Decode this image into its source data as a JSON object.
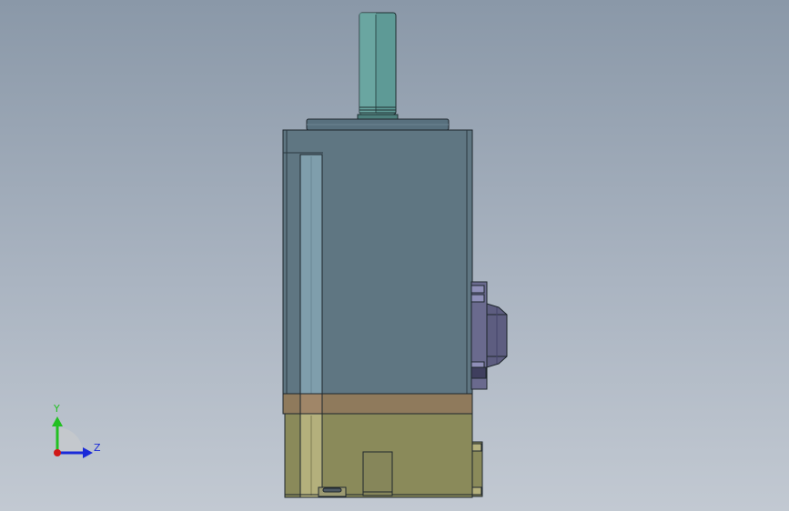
{
  "viewport": {
    "background_top": "#8a98a8",
    "background_bottom": "#c2c9d2"
  },
  "model": {
    "parts": [
      "motor-shaft",
      "shaft-flange",
      "motor-body",
      "side-rail",
      "brown-band",
      "gearbox-base",
      "base-slot",
      "base-clip",
      "side-connector",
      "side-terminal"
    ],
    "colors": {
      "shaft": "#5e9a96",
      "flange": "#58707e",
      "body": "#5f7682",
      "rail": "#7f9eac",
      "band": "#8f7a5c",
      "base": "#8a8a5a",
      "connector": "#6a6a8e",
      "edge": "#1e262c"
    }
  },
  "triad": {
    "y_label": "Y",
    "z_label": "Z",
    "y_color": "#22c022",
    "z_color": "#1a2ad8",
    "origin_color": "#d01818"
  }
}
